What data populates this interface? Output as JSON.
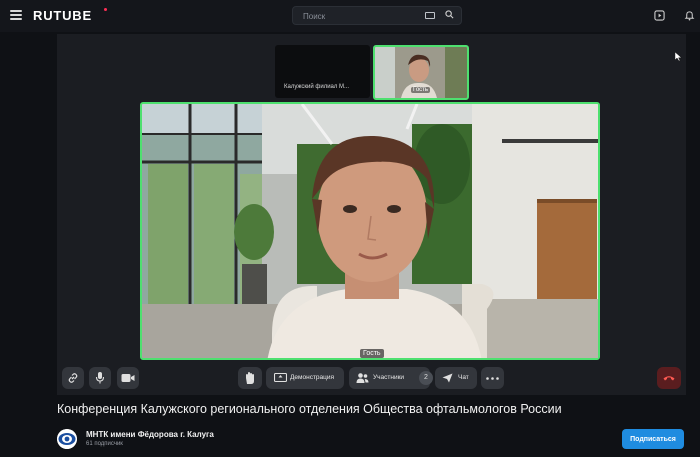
{
  "header": {
    "logo": "RUTUBE",
    "search_placeholder": "Поиск"
  },
  "conference": {
    "tile_dark_label": "Калужский филиал М...",
    "tile_guest_label": "Гость",
    "main_speaker_label": "Гость"
  },
  "controls": {
    "demo_label": "Демонстрация",
    "participants_label": "Участники",
    "participants_count": "2",
    "chat_label": "Чат"
  },
  "video": {
    "title": "Конференция Калужского регионального отделения Общества офтальмологов России"
  },
  "channel": {
    "name": "МНТК имени Фёдорова г. Калуга",
    "subscribers": "61 подписчик",
    "subscribe_label": "Подписаться"
  },
  "colors": {
    "active_border": "#4ee06f",
    "subscribe": "#1f8ce0",
    "hangup": "#5a1d1f",
    "brand_dot": "#ff2e55"
  }
}
